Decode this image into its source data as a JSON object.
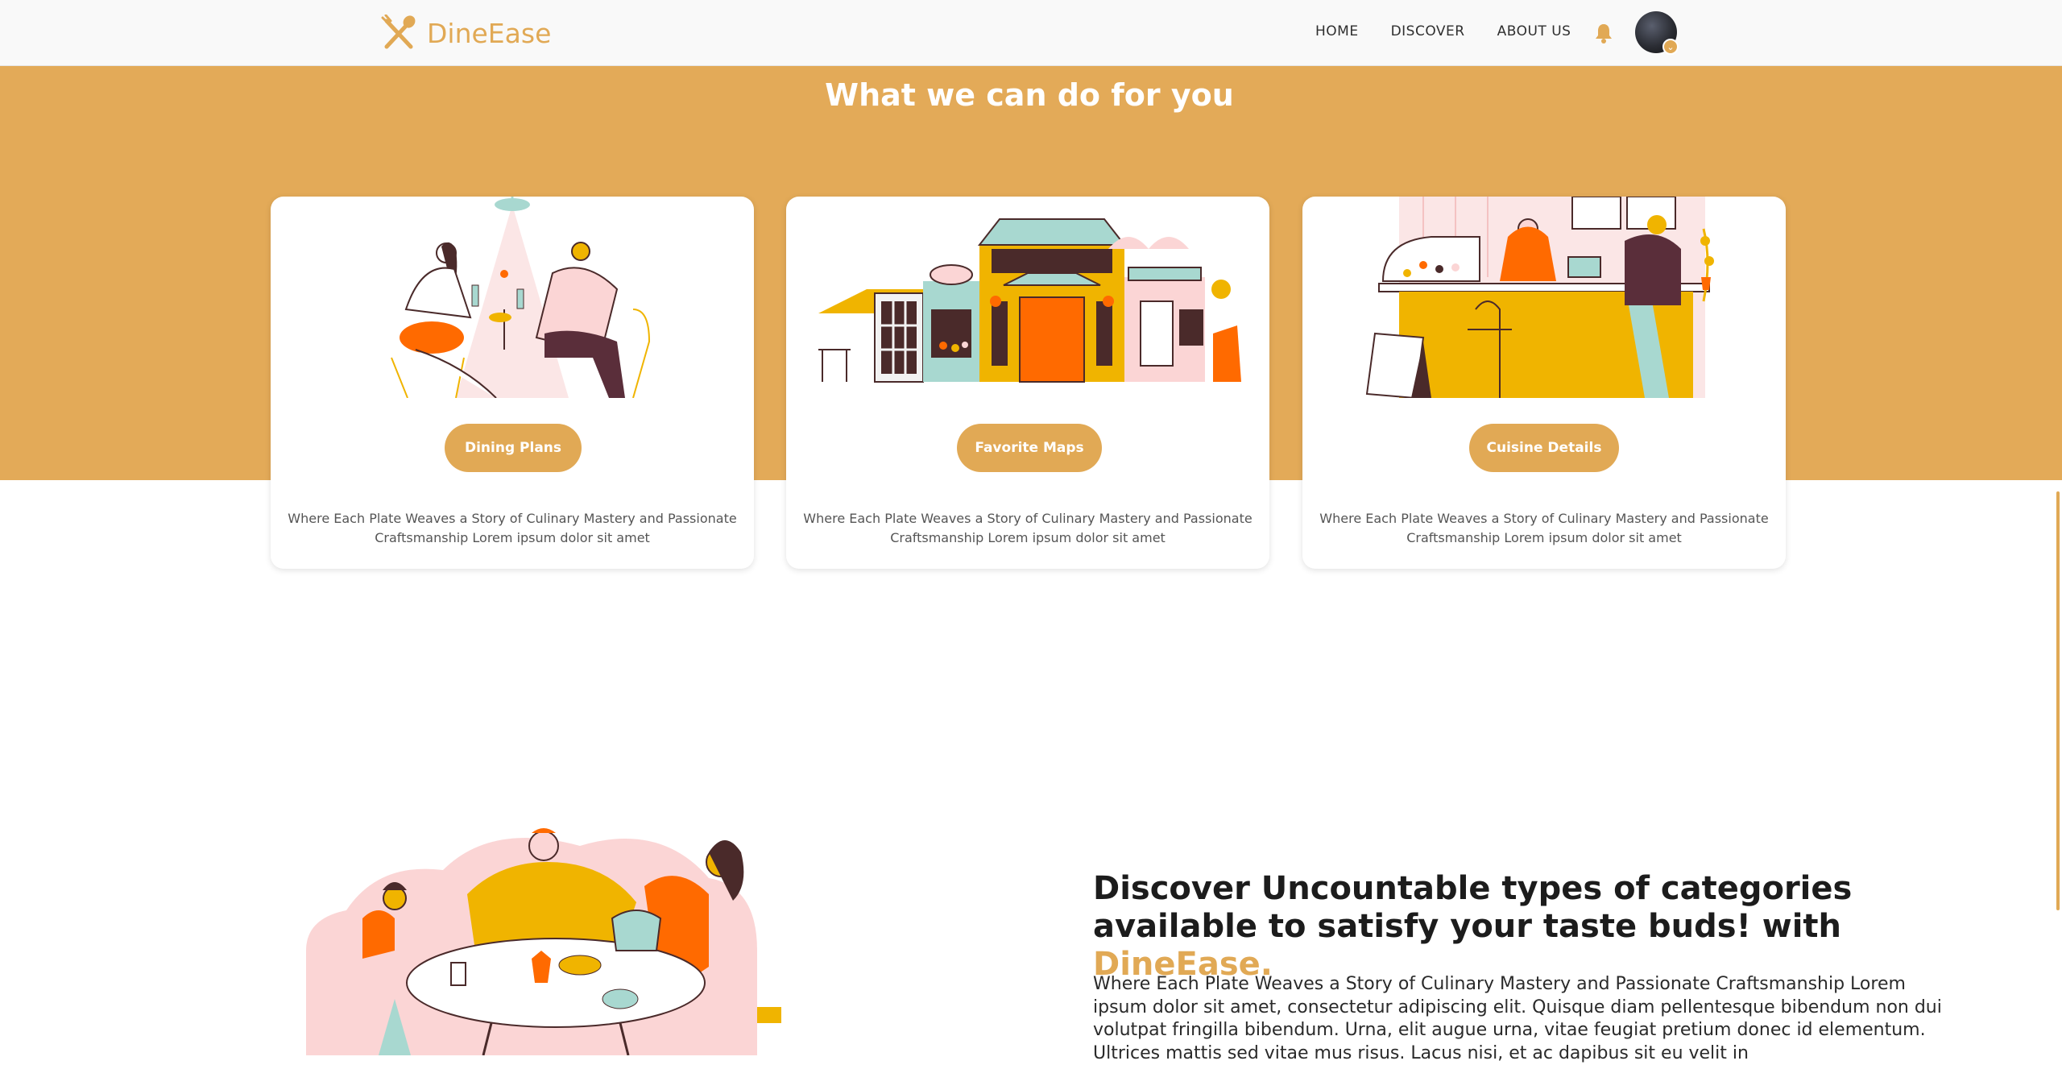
{
  "nav": {
    "brand": "DineEase",
    "links": [
      "HOME",
      "DISCOVER",
      "ABOUT US"
    ]
  },
  "colors": {
    "accent": "#e3aa58",
    "brand": "#e1a955"
  },
  "services": {
    "title": "What we can do for you",
    "cards": [
      {
        "button": "Dining Plans",
        "text": "Where Each Plate Weaves a Story of Culinary Mastery and Passionate Craftsmanship Lorem ipsum dolor sit amet"
      },
      {
        "button": "Favorite Maps",
        "text": "Where Each Plate Weaves a Story of Culinary Mastery and Passionate Craftsmanship Lorem ipsum dolor sit amet"
      },
      {
        "button": "Cuisine Details",
        "text": "Where Each Plate Weaves a Story of Culinary Mastery and Passionate Craftsmanship Lorem ipsum dolor sit amet"
      }
    ]
  },
  "discover": {
    "heading": "Discover Uncountable types of categories available to satisfy your taste buds! with",
    "brand": "DineEase.",
    "text": "Where Each Plate Weaves a Story of Culinary Mastery and Passionate Craftsmanship Lorem ipsum dolor sit amet, consectetur adipiscing elit. Quisque diam pellentesque bibendum non dui volutpat fringilla bibendum. Urna, elit augue urna, vitae feugiat pretium donec id elementum. Ultrices mattis sed vitae mus risus. Lacus nisi, et ac dapibus sit eu velit in"
  }
}
